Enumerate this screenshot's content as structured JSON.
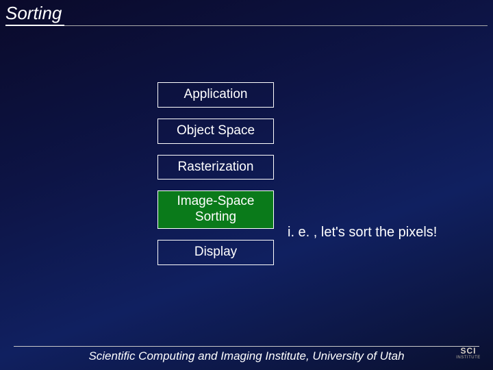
{
  "title": "Sorting",
  "stages": {
    "application": "Application",
    "object_space": "Object Space",
    "rasterization": "Rasterization",
    "image_space_sorting": "Image-Space Sorting",
    "display": "Display"
  },
  "annotation": "i. e. , let's sort the pixels!",
  "footer": "Scientific Computing and Imaging Institute, University of Utah",
  "logo": {
    "line1": "SCI",
    "line2": "INSTITUTE"
  },
  "colors": {
    "highlight_bg": "#0a7a1a"
  }
}
